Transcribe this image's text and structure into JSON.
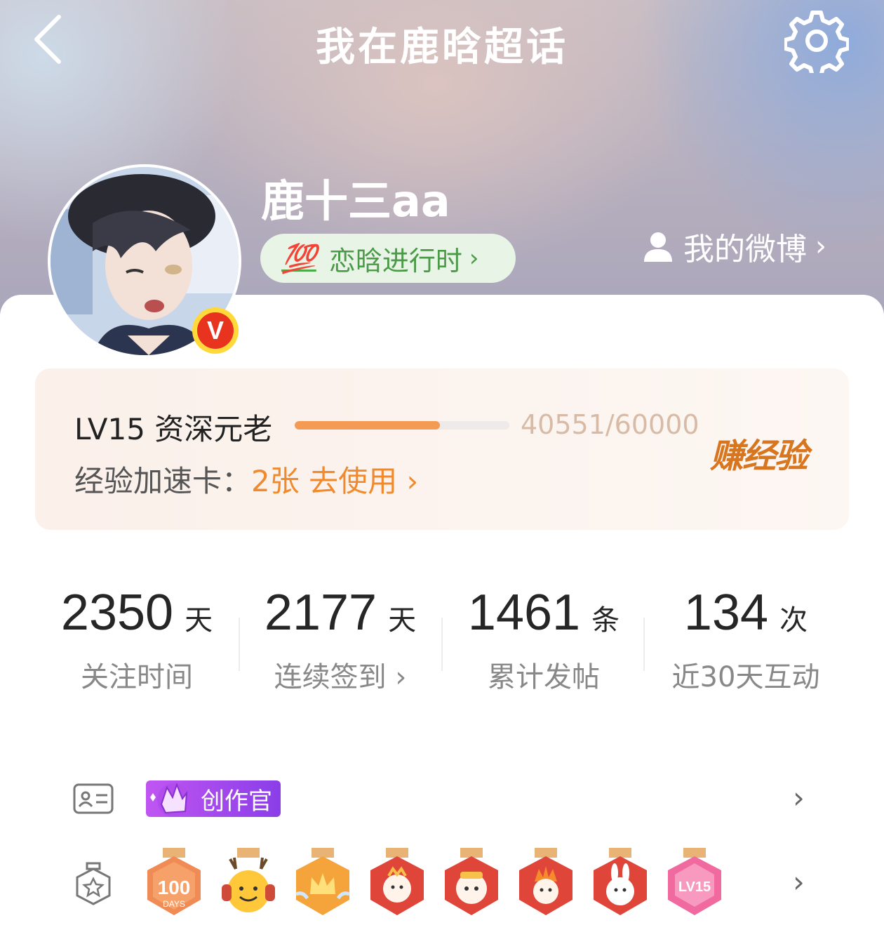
{
  "header": {
    "title": "我在鹿晗超话",
    "back_icon": "chevron-left-icon",
    "settings_icon": "gear-icon"
  },
  "profile": {
    "username": "鹿十三aa",
    "vip_badge": "V",
    "status_icon": "💯",
    "status_label": "恋晗进行时",
    "my_weibo_label": "我的微博"
  },
  "level": {
    "name": "LV15 资深元老",
    "exp_text": "40551/60000",
    "progress": 0.676,
    "boost_label": "经验加速卡：",
    "boost_count": "2张",
    "boost_action": "去使用",
    "earn_exp_label": "赚经验",
    "accent_color": "#f39a55"
  },
  "stats": [
    {
      "value": "2350",
      "unit": "天",
      "caption": "关注时间"
    },
    {
      "value": "2177",
      "unit": "天",
      "caption": "连续签到"
    },
    {
      "value": "1461",
      "unit": "条",
      "caption": "累计发帖"
    },
    {
      "value": "134",
      "unit": "次",
      "caption": "近30天互动"
    }
  ],
  "badges": {
    "creator_label": "创作官",
    "medals": [
      {
        "icon": "100-days-medal-icon",
        "text": "100",
        "subtext": "DAYS"
      },
      {
        "icon": "deer-music-medal-icon"
      },
      {
        "icon": "crown-medal-icon"
      },
      {
        "icon": "dragon-new-year-medal-1-icon"
      },
      {
        "icon": "dragon-new-year-medal-2-icon"
      },
      {
        "icon": "dragon-new-year-medal-3-icon"
      },
      {
        "icon": "rabbit-medal-icon"
      },
      {
        "icon": "lv15-medal-icon",
        "text": "LV15"
      }
    ]
  }
}
